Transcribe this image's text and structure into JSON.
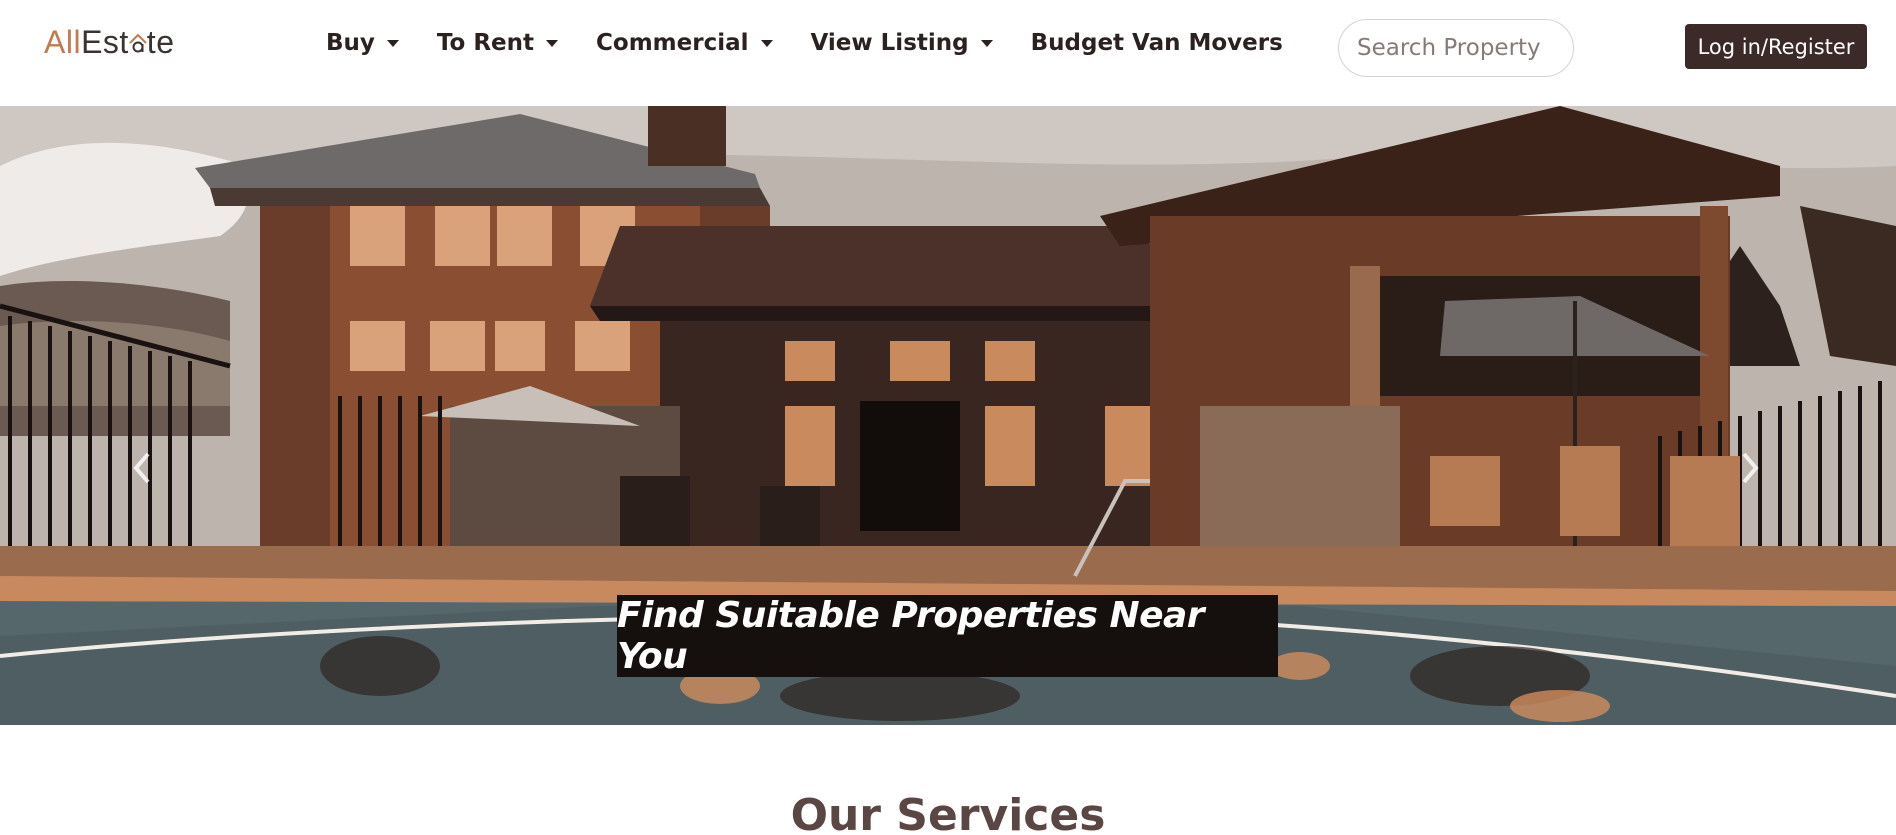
{
  "logo": {
    "part1": "All",
    "part2": "Est",
    "part3": "te"
  },
  "nav": {
    "items": [
      {
        "label": "Buy",
        "has_dropdown": true
      },
      {
        "label": "To Rent",
        "has_dropdown": true
      },
      {
        "label": "Commercial",
        "has_dropdown": true
      },
      {
        "label": "View Listing",
        "has_dropdown": true
      },
      {
        "label": "Budget Van Movers",
        "has_dropdown": false
      }
    ]
  },
  "search": {
    "placeholder": "Search Property",
    "value": ""
  },
  "auth": {
    "login_label": "Log in/Register"
  },
  "hero": {
    "caption": "Find Suitable Properties Near You",
    "prev_icon": "chevron-left-icon",
    "next_icon": "chevron-right-icon"
  },
  "services": {
    "title": "Our Services"
  },
  "colors": {
    "brand_dark": "#3b2a27",
    "brand_accent": "#c27b4e",
    "caption_bg": "#150f0d",
    "services_title": "#5a4642"
  }
}
